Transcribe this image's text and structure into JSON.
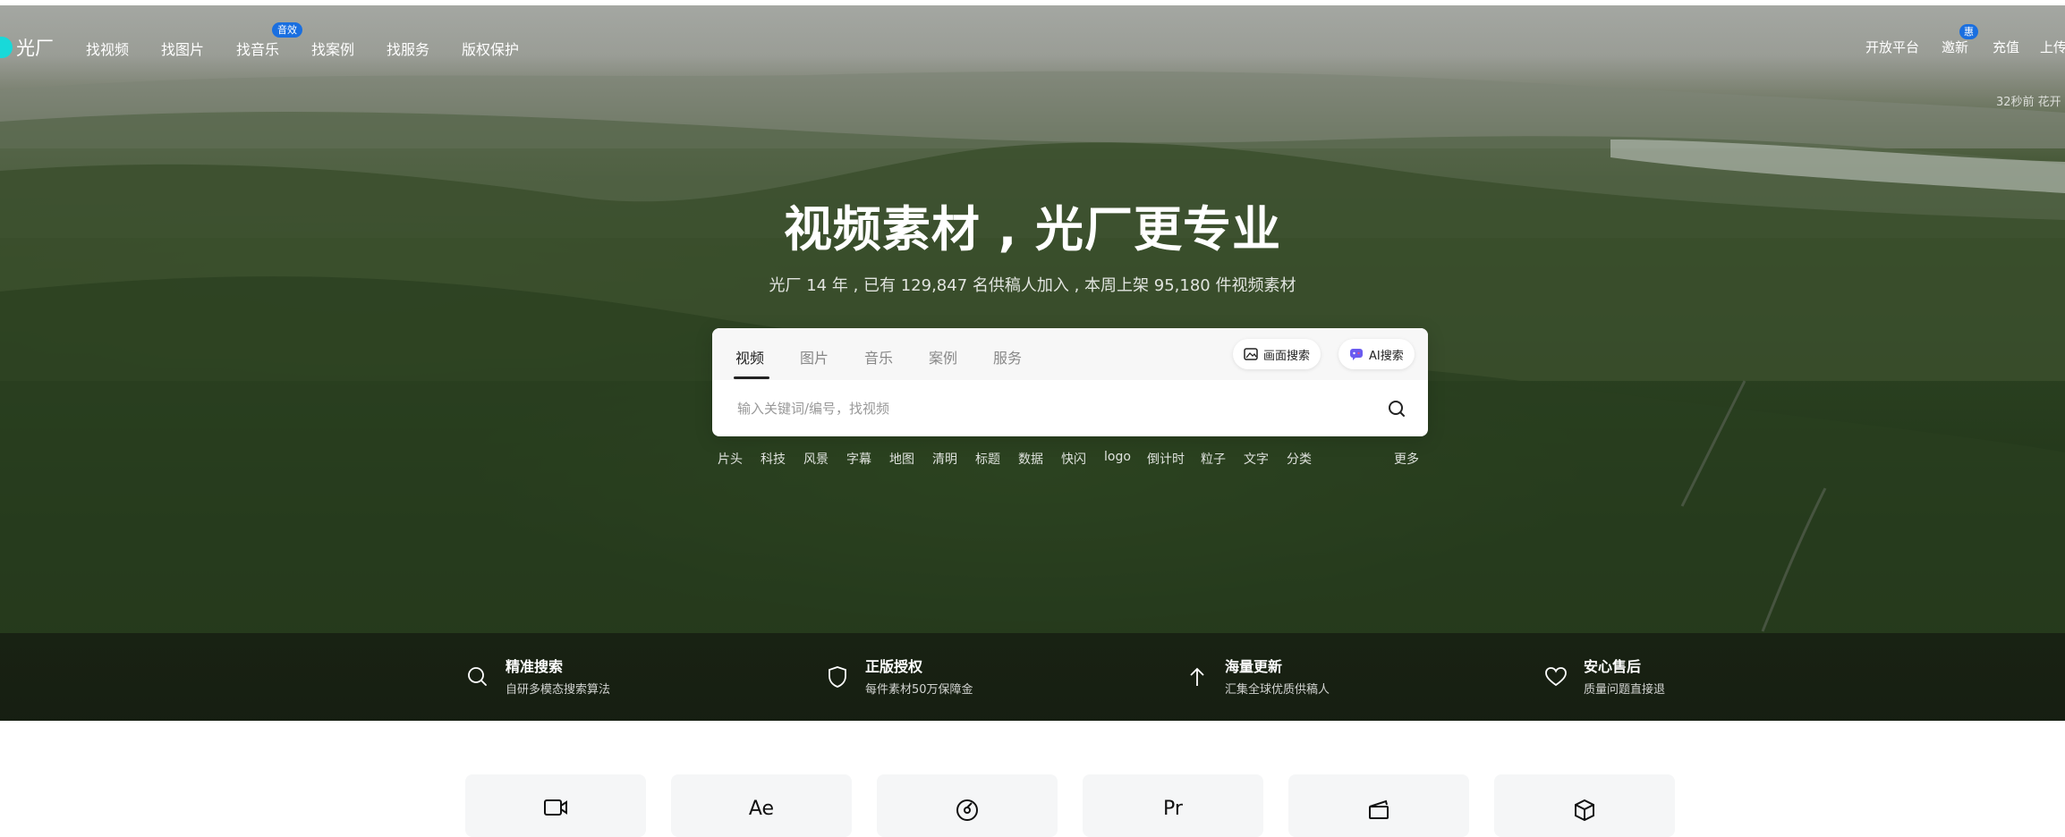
{
  "nav": {
    "logo_text": "光厂",
    "items": [
      {
        "label": "找视频"
      },
      {
        "label": "找图片"
      },
      {
        "label": "找音乐",
        "badge": "音效"
      },
      {
        "label": "找案例"
      },
      {
        "label": "找服务"
      },
      {
        "label": "版权保护"
      }
    ],
    "right_items": [
      {
        "label": "开放平台"
      },
      {
        "label": "邀新",
        "badge": "惠"
      },
      {
        "label": "充值"
      },
      {
        "label": "上传"
      }
    ],
    "ticker": "32秒前 花开"
  },
  "hero": {
    "title": "视频素材 , 光厂更专业",
    "subtitle": "光厂  14  年 , 已有 129,847 名供稿人加入 , 本周上架 95,180 件视频素材"
  },
  "search": {
    "tabs": [
      "视频",
      "图片",
      "音乐",
      "案例",
      "服务"
    ],
    "active_tab": "视频",
    "image_search_label": "画面搜索",
    "ai_search_label": "AI搜索",
    "placeholder": "输入关键词/编号，找视频",
    "value": ""
  },
  "hot_tags": [
    "片头",
    "科技",
    "风景",
    "字幕",
    "地图",
    "清明",
    "标题",
    "数据",
    "快闪",
    "logo",
    "倒计时",
    "粒子",
    "文字",
    "分类"
  ],
  "more_label": "更多",
  "features": [
    {
      "icon": "search-icon",
      "title": "精准搜索",
      "desc": "自研多模态搜索算法"
    },
    {
      "icon": "shield-icon",
      "title": "正版授权",
      "desc": "每件素材50万保障金"
    },
    {
      "icon": "arrow-up-icon",
      "title": "海量更新",
      "desc": "汇集全球优质供稿人"
    },
    {
      "icon": "heart-icon",
      "title": "安心售后",
      "desc": "质量问题直接退"
    }
  ],
  "categories": [
    {
      "icon": "video-camera-icon",
      "text": ""
    },
    {
      "icon": "ae-icon",
      "text": "Ae"
    },
    {
      "icon": "music-disc-icon",
      "text": ""
    },
    {
      "icon": "pr-icon",
      "text": "Pr"
    },
    {
      "icon": "clapperboard-icon",
      "text": ""
    },
    {
      "icon": "cube-icon",
      "text": ""
    }
  ],
  "colors": {
    "accent": "#1a6fe0",
    "logo": "#18d9d9",
    "ai_pill_icon": "#6b5cf0"
  }
}
